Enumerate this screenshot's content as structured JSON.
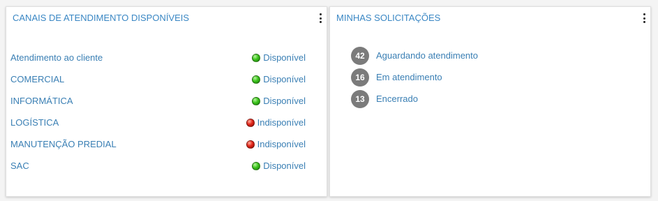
{
  "channels_panel": {
    "title": "CANAIS DE ATENDIMENTO DISPONÍVEIS",
    "items": [
      {
        "name": "Atendimento ao cliente",
        "status": "Disponível",
        "state": "available"
      },
      {
        "name": "COMERCIAL",
        "status": "Disponível",
        "state": "available"
      },
      {
        "name": "INFORMÁTICA",
        "status": "Disponível",
        "state": "available"
      },
      {
        "name": "LOGÍSTICA",
        "status": "Indisponível",
        "state": "unavailable"
      },
      {
        "name": "MANUTENÇÃO PREDIAL",
        "status": "Indisponível",
        "state": "unavailable"
      },
      {
        "name": "SAC",
        "status": "Disponível",
        "state": "available"
      }
    ]
  },
  "requests_panel": {
    "title": "MINHAS SOLICITAÇÕES",
    "items": [
      {
        "count": "42",
        "label": "Aguardando atendimento"
      },
      {
        "count": "16",
        "label": "Em atendimento"
      },
      {
        "count": "13",
        "label": "Encerrado"
      }
    ]
  },
  "colors": {
    "title_blue": "#3a87c4",
    "link_blue": "#3a7fb4",
    "badge_gray": "#7b7b7b",
    "status_green": "#3cc51c",
    "status_red": "#e2261a"
  },
  "icons": {
    "menu": "kebab-menu-icon",
    "available": "green-dot-icon",
    "unavailable": "red-dot-icon"
  }
}
